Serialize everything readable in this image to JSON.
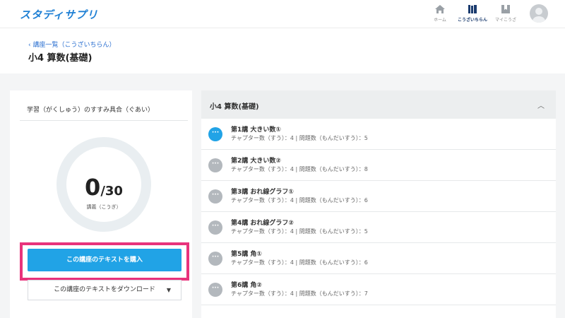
{
  "header": {
    "logo": "スタディサプリ",
    "nav": [
      {
        "label": "ホーム",
        "icon": "home-icon"
      },
      {
        "label": "こうざいちらん",
        "icon": "books-icon"
      },
      {
        "label": "マイこうざ",
        "icon": "bookmark-icon"
      }
    ],
    "avatar_icon": "user-avatar-icon"
  },
  "breadcrumb": {
    "label": "講座一覧（こうざいちらん）",
    "icon": "chevron-left-icon"
  },
  "page": {
    "title": "小4 算数(基礎)"
  },
  "progress": {
    "title": "学習（がくしゅう）のすすみ具合（ぐあい）",
    "done": "0",
    "total": "/30",
    "unit": "講義（こうぎ）",
    "fraction": 0
  },
  "actions": {
    "buy_label": "この講座のテキストを購入",
    "download_label": "この講座のテキストをダウンロード",
    "download_caret": "▼"
  },
  "course": {
    "header_title": "小4 算数(基礎)",
    "collapse_icon": "︿",
    "dot_glyph": "···",
    "lessons": [
      {
        "name": "第1講 大きい数①",
        "meta": "チャプター数（すう）：4 | 問題数（もんだいすう）：5",
        "active": true
      },
      {
        "name": "第2講 大きい数②",
        "meta": "チャプター数（すう）：4 | 問題数（もんだいすう）：8",
        "active": false
      },
      {
        "name": "第3講 おれ線グラフ①",
        "meta": "チャプター数（すう）：4 | 問題数（もんだいすう）：6",
        "active": false
      },
      {
        "name": "第4講 おれ線グラフ②",
        "meta": "チャプター数（すう）：4 | 問題数（もんだいすう）：5",
        "active": false
      },
      {
        "name": "第5講 角①",
        "meta": "チャプター数（すう）：4 | 問題数（もんだいすう）：6",
        "active": false
      },
      {
        "name": "第6講 角②",
        "meta": "チャプター数（すう）：4 | 問題数（もんだいすう）：7",
        "active": false
      }
    ]
  },
  "colors": {
    "accent": "#21a3e6",
    "highlight": "#e8337c",
    "logo": "#1e7fd4"
  }
}
